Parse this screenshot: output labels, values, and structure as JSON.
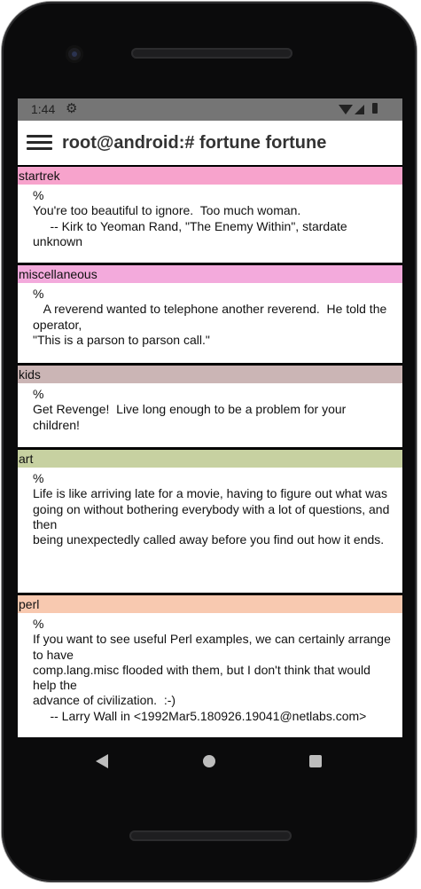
{
  "status_bar": {
    "time": "1:44",
    "settings_icon": "gear-icon",
    "wifi_icon": "wifi-icon",
    "signal_icon": "signal-icon",
    "battery_icon": "battery-icon"
  },
  "app_bar": {
    "menu_icon": "menu-icon",
    "title": "root@android:# fortune fortune"
  },
  "fortunes": [
    {
      "category": "startrek",
      "color": "#f7a3cc",
      "text": "%\nYou're too beautiful to ignore.  Too much woman.\n     -- Kirk to Yeoman Rand, \"The Enemy Within\", stardate unknown"
    },
    {
      "category": "miscellaneous",
      "color": "#f3aadc",
      "text": "%\n   A reverend wanted to telephone another reverend.  He told the operator,\n\"This is a parson to parson call.\""
    },
    {
      "category": "kids",
      "color": "#cbb5b5",
      "text": "%\nGet Revenge!  Live long enough to be a problem for your children!"
    },
    {
      "category": "art",
      "color": "#c7d1a1",
      "text": "%\nLife is like arriving late for a movie, having to figure out what was\ngoing on without bothering everybody with a lot of questions, and then\nbeing unexpectedly called away before you find out how it ends."
    },
    {
      "category": "perl",
      "color": "#f8c9b0",
      "text": "%\nIf you want to see useful Perl examples, we can certainly arrange to have\ncomp.lang.misc flooded with them, but I don't think that would help the\nadvance of civilization.  :-)\n     -- Larry Wall in <1992Mar5.180926.19041@netlabs.com>"
    }
  ],
  "nav_bar": {
    "back_icon": "back-icon",
    "home_icon": "home-icon",
    "recents_icon": "recents-icon"
  }
}
